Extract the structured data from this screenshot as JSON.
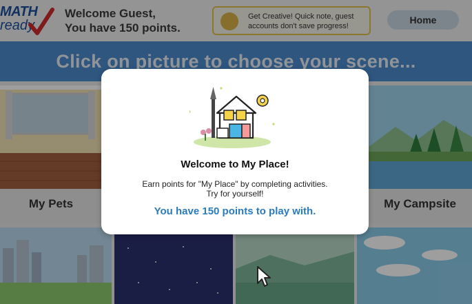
{
  "header": {
    "logo_top": "MATH",
    "logo_bottom": "ready",
    "welcome_line1": "Welcome Guest,",
    "welcome_line2": "You have 150 points.",
    "tip": "Get Creative! Quick note, guest accounts don't save progress!",
    "home_label": "Home"
  },
  "banner": {
    "text": "Click on picture to choose your scene..."
  },
  "scenes": {
    "row1_left_label": "My Pets",
    "row1_right_label": "My Campsite"
  },
  "dialog": {
    "title": "Welcome to My Place!",
    "body_line1": "Earn points for \"My Place\" by completing activities.",
    "body_line2": "Try for yourself!",
    "points_message": "You have 150 points to play with."
  },
  "colors": {
    "banner": "#4b8ccd",
    "points_text": "#2b7bbf",
    "tip_border": "#e3c04c",
    "home_button": "#c9d6e3"
  }
}
